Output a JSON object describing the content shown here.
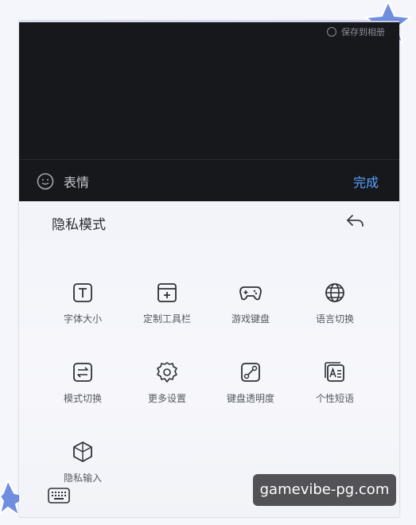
{
  "topbar": {
    "save_label": "保存到相册"
  },
  "input_bar": {
    "emoji_label": "表情",
    "done_label": "完成"
  },
  "panel": {
    "title": "隐私模式",
    "items": [
      {
        "label": "字体大小",
        "icon": "font-size-icon"
      },
      {
        "label": "定制工具栏",
        "icon": "toolbar-icon"
      },
      {
        "label": "游戏键盘",
        "icon": "gamepad-icon"
      },
      {
        "label": "语言切换",
        "icon": "globe-icon"
      },
      {
        "label": "模式切换",
        "icon": "switch-icon"
      },
      {
        "label": "更多设置",
        "icon": "gear-icon"
      },
      {
        "label": "键盘透明度",
        "icon": "transparency-icon"
      },
      {
        "label": "个性短语",
        "icon": "phrase-icon"
      },
      {
        "label": "隐私输入",
        "icon": "privacy-input-icon"
      }
    ]
  },
  "watermark": {
    "text": "gamevibe-pg.com"
  }
}
